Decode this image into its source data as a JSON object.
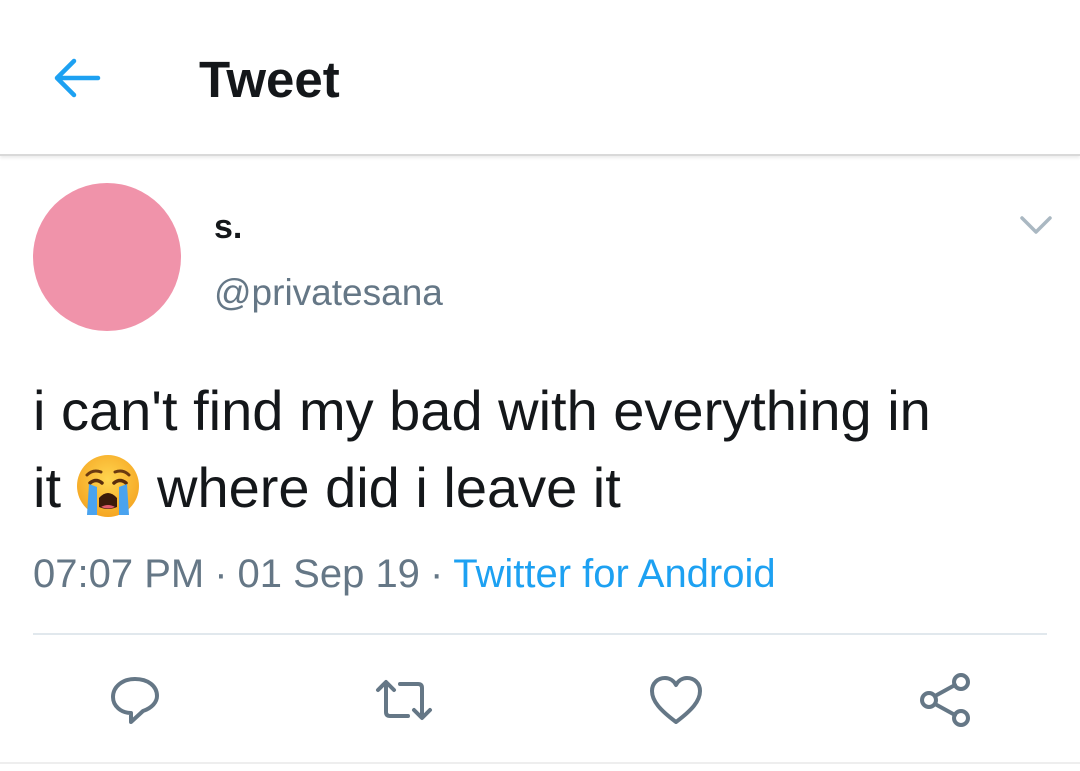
{
  "header": {
    "title": "Tweet",
    "back_icon": "arrow-left-icon"
  },
  "tweet": {
    "author": {
      "display_name": "s.",
      "handle": "@privatesana",
      "avatar_color": "#f093aa"
    },
    "text_line1": "i can't find my bad with everything in",
    "text_line2_before": "it",
    "text_emoji": "loudly-crying-face-emoji",
    "text_line2_after": "where did i leave it",
    "time": "07:07 PM",
    "separator": "·",
    "date": "01 Sep 19",
    "source": "Twitter for Android"
  },
  "actions": [
    {
      "name": "reply",
      "icon": "speech-bubble-icon"
    },
    {
      "name": "retweet",
      "icon": "retweet-icon"
    },
    {
      "name": "like",
      "icon": "heart-icon"
    },
    {
      "name": "share",
      "icon": "share-icon"
    }
  ],
  "colors": {
    "accent": "#1da1f2",
    "text": "#14171a",
    "secondary": "#657786"
  }
}
